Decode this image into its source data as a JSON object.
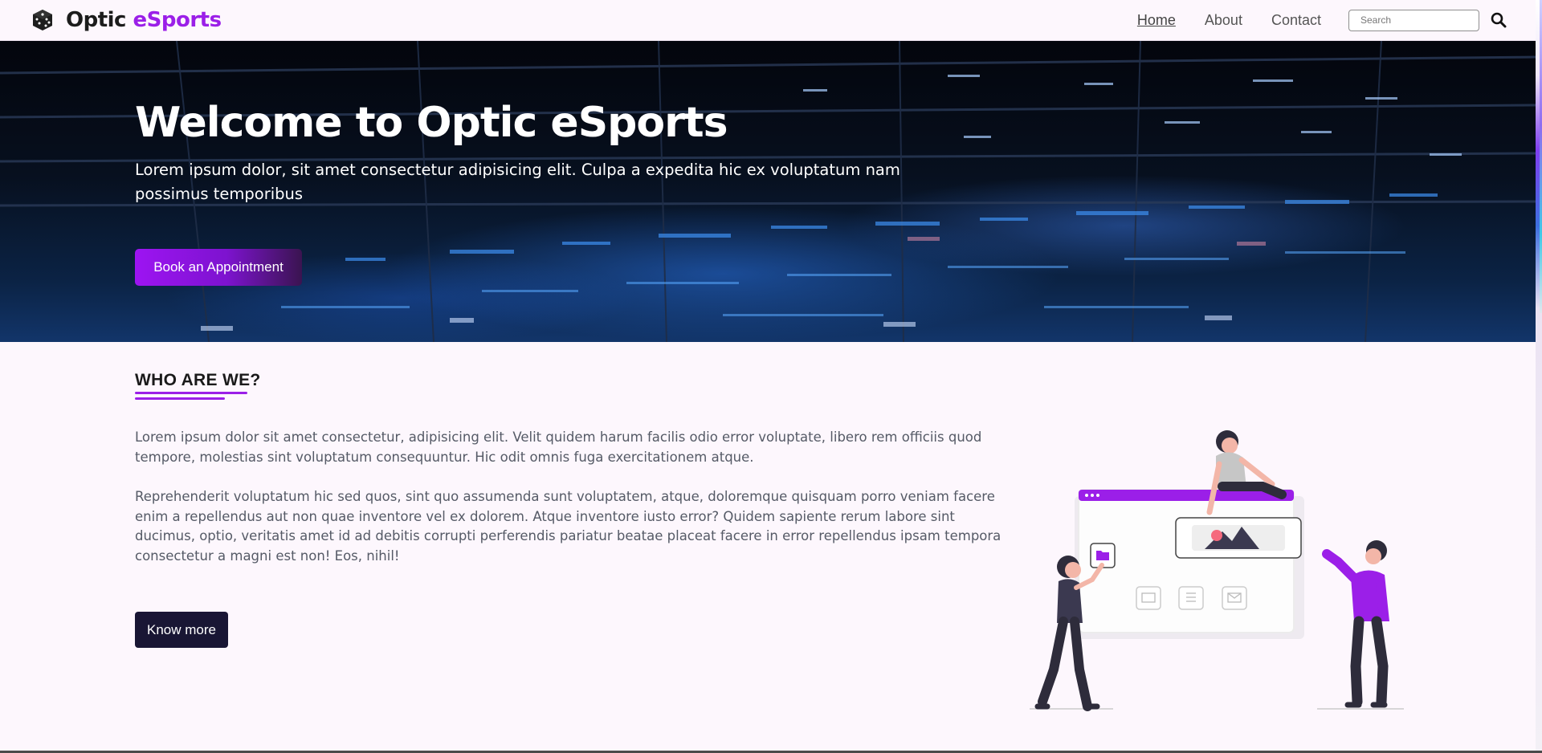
{
  "navbar": {
    "brand_name": "Optic",
    "brand_accent": "eSports",
    "brand_icon": "dice-icon",
    "links": [
      {
        "label": "Home",
        "active": true
      },
      {
        "label": "About",
        "active": false
      },
      {
        "label": "Contact",
        "active": false
      }
    ],
    "search": {
      "placeholder": "Search",
      "value": ""
    },
    "search_icon": "search-icon"
  },
  "hero": {
    "title": "Welcome to Optic eSports",
    "subtitle": "Lorem ipsum dolor, sit amet consectetur adipisicing elit. Culpa a expedita hic ex voluptatum nam possimus temporibus",
    "cta_label": "Book an Appointment"
  },
  "about": {
    "heading": "WHO ARE WE?",
    "paragraphs": [
      "Lorem ipsum dolor sit amet consectetur, adipisicing elit. Velit quidem harum facilis odio error voluptate, libero rem officiis quod tempore, molestias sint voluptatum consequuntur. Hic odit omnis fuga exercitationem atque.",
      "Reprehenderit voluptatum hic sed quos, sint quo assumenda sunt voluptatem, atque, doloremque quisquam porro veniam facere enim a repellendus aut non quae inventore vel ex dolorem. Atque inventore iusto error? Quidem sapiente rerum labore sint ducimus, optio, veritatis amet id ad debitis corrupti perferendis pariatur beatae placeat facere in error repellendus ipsam tempora consectetur a magni est non! Eos, nihil!"
    ],
    "button_label": "Know more",
    "illustration": "team-collaboration-illustration"
  },
  "colors": {
    "accent": "#9b1fe8",
    "dark_button": "#191634",
    "page_background": "#fdf7fd"
  }
}
